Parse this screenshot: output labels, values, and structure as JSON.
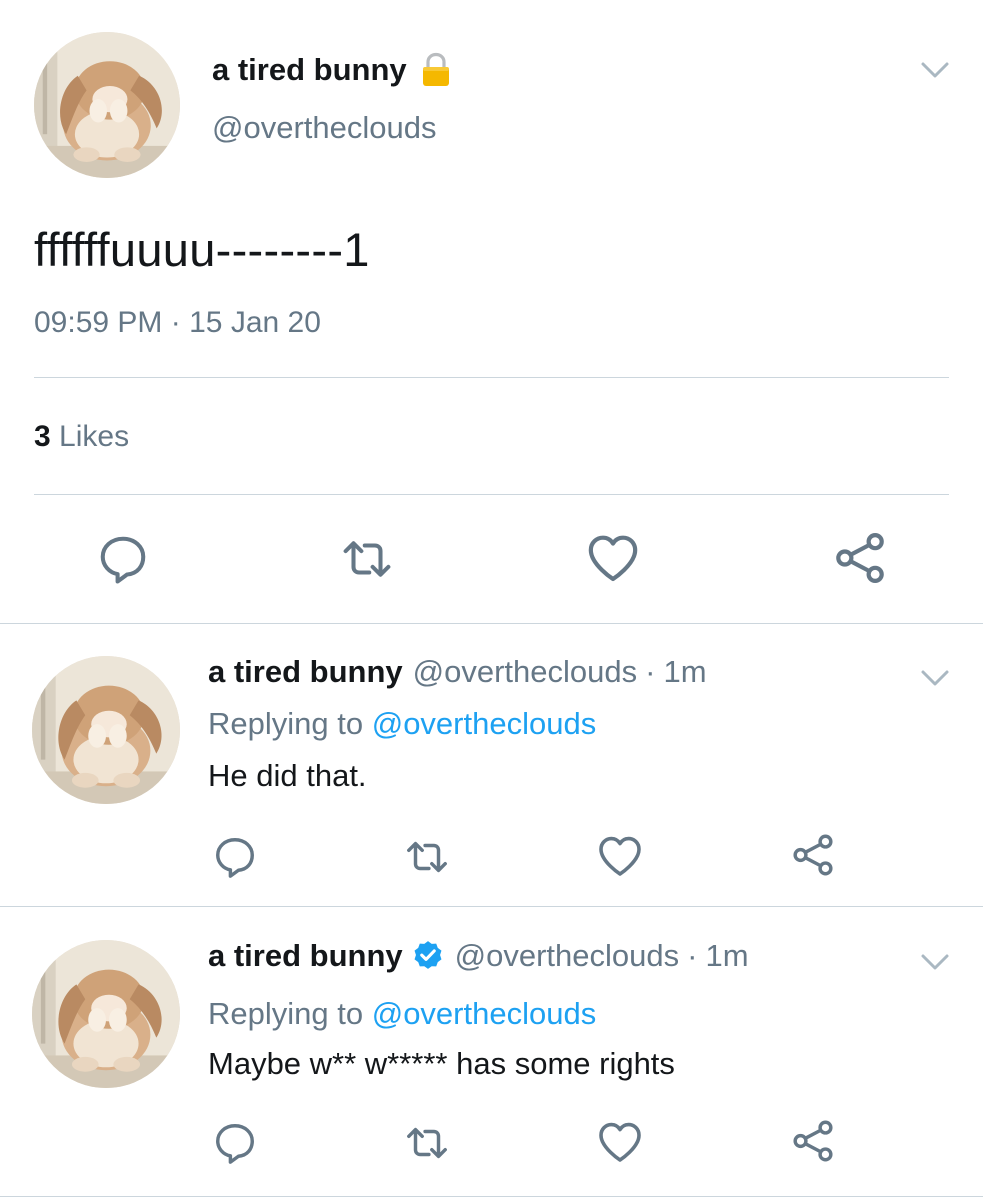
{
  "main_tweet": {
    "author_name": "a tired bunny",
    "author_handle": "@overtheclouds",
    "text": "ffffffuuuu--------1",
    "time": "09:59 PM",
    "date": "15 Jan 20",
    "likes_count": "3",
    "likes_label": "Likes"
  },
  "replies": [
    {
      "author_name": "a tired bunny",
      "author_handle": "@overtheclouds",
      "time": "1m",
      "replying_label": "Replying to",
      "replying_to": "@overtheclouds",
      "text": "He did that.",
      "verified": false
    },
    {
      "author_name": "a tired bunny",
      "author_handle": "@overtheclouds",
      "time": "1m",
      "replying_label": "Replying to",
      "replying_to": "@overtheclouds",
      "text": "Maybe w** w***** has some rights",
      "verified": true
    }
  ],
  "separator": "·",
  "icons": {
    "reply": "reply-icon",
    "retweet": "retweet-icon",
    "like": "heart-icon",
    "share": "share-icon",
    "menu": "chevron-down-icon",
    "lock": "lock-icon",
    "verified": "verified-badge-icon"
  },
  "colors": {
    "text": "#14171a",
    "secondary": "#657786",
    "link": "#1da1f2",
    "divider": "#ccd6dd",
    "icon": "#657786",
    "lock": "#f5b800"
  }
}
